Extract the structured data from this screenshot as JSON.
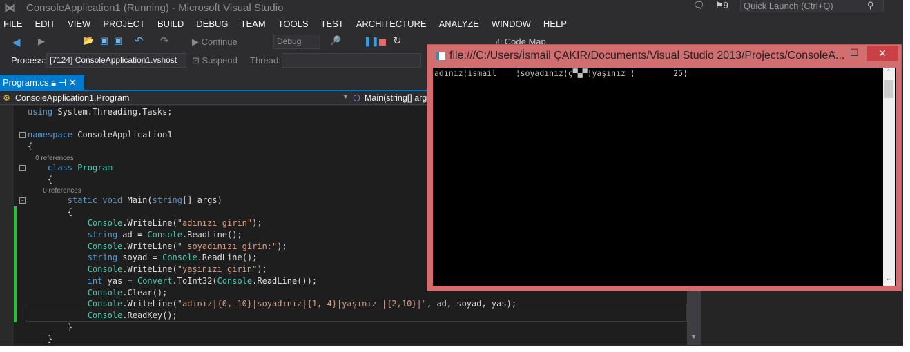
{
  "window": {
    "title": "ConsoleApplication1 (Running) - Microsoft Visual Studio",
    "quick_launch_placeholder": "Quick Launch (Ctrl+Q)",
    "notification_count": "9"
  },
  "menu": [
    "FILE",
    "EDIT",
    "VIEW",
    "PROJECT",
    "BUILD",
    "DEBUG",
    "TEAM",
    "TOOLS",
    "TEST",
    "ARCHITECTURE",
    "ANALYZE",
    "WINDOW",
    "HELP"
  ],
  "toolbar": {
    "continue": "Continue",
    "config": "Debug",
    "code_map": "Code Map",
    "process_label": "Process:",
    "process_value": "[7124] ConsoleApplication1.vshost",
    "suspend": "Suspend",
    "thread_label": "Thread:"
  },
  "tab": {
    "label": "Program.cs"
  },
  "navbar": {
    "class": "ConsoleApplication1.Program",
    "member": "Main(string[] args)"
  },
  "code": [
    [
      [
        "kw",
        "using"
      ],
      [
        "pl",
        " System.Threading.Tasks;"
      ]
    ],
    [],
    [
      [
        "kw",
        "namespace"
      ],
      [
        "pl",
        " ConsoleApplication1"
      ]
    ],
    [
      [
        "pl",
        "{"
      ]
    ],
    [
      [
        "refs",
        "    0 references"
      ]
    ],
    [
      [
        "pl",
        "    "
      ],
      [
        "kw",
        "class"
      ],
      [
        "pl",
        " "
      ],
      [
        "ty",
        "Program"
      ]
    ],
    [
      [
        "pl",
        "    {"
      ]
    ],
    [
      [
        "refs",
        "        0 references"
      ]
    ],
    [
      [
        "pl",
        "        "
      ],
      [
        "kw",
        "static void"
      ],
      [
        "pl",
        " Main("
      ],
      [
        "kw",
        "string"
      ],
      [
        "pl",
        "[] args)"
      ]
    ],
    [
      [
        "pl",
        "        {"
      ]
    ],
    [
      [
        "pl",
        "            "
      ],
      [
        "ty",
        "Console"
      ],
      [
        "pl",
        ".WriteLine("
      ],
      [
        "st",
        "\"adınızı girin\""
      ],
      [
        "pl",
        ");"
      ]
    ],
    [
      [
        "pl",
        "            "
      ],
      [
        "kw",
        "string"
      ],
      [
        "pl",
        " ad = "
      ],
      [
        "ty",
        "Console"
      ],
      [
        "pl",
        ".ReadLine();"
      ]
    ],
    [
      [
        "pl",
        "            "
      ],
      [
        "ty",
        "Console"
      ],
      [
        "pl",
        ".WriteLine("
      ],
      [
        "st",
        "\" soyadınızı girin:\""
      ],
      [
        "pl",
        ");"
      ]
    ],
    [
      [
        "pl",
        "            "
      ],
      [
        "kw",
        "string"
      ],
      [
        "pl",
        " soyad = "
      ],
      [
        "ty",
        "Console"
      ],
      [
        "pl",
        ".ReadLine();"
      ]
    ],
    [
      [
        "pl",
        "            "
      ],
      [
        "ty",
        "Console"
      ],
      [
        "pl",
        ".WriteLine("
      ],
      [
        "st",
        "\"yaşınızı girin\""
      ],
      [
        "pl",
        ");"
      ]
    ],
    [
      [
        "pl",
        "            "
      ],
      [
        "kw",
        "int"
      ],
      [
        "pl",
        " yas = "
      ],
      [
        "ty",
        "Convert"
      ],
      [
        "pl",
        ".ToInt32("
      ],
      [
        "ty",
        "Console"
      ],
      [
        "pl",
        ".ReadLine());"
      ]
    ],
    [
      [
        "pl",
        "            "
      ],
      [
        "ty",
        "Console"
      ],
      [
        "pl",
        ".Clear();"
      ]
    ],
    [
      [
        "pl",
        "            "
      ],
      [
        "ty",
        "Console"
      ],
      [
        "pl",
        ".WriteLine("
      ],
      [
        "st",
        "\"adınız|{0,-10}|soyadınız|{1,-4}|yaşınız |{2,10}|\""
      ],
      [
        "pl",
        ", ad, soyad, yas);"
      ]
    ],
    [
      [
        "pl",
        "            "
      ],
      [
        "ty",
        "Console"
      ],
      [
        "pl",
        ".ReadKey();"
      ]
    ],
    [
      [
        "pl",
        "        }"
      ]
    ],
    [
      [
        "pl",
        "    }"
      ]
    ]
  ],
  "console": {
    "title": "file:///C:/Users/İsmail ÇAKIR/Documents/Visual Studio 2013/Projects/ConsoleA...",
    "output": "adınız¦ismail    ¦soyadınız¦ç▀▄▀¦yaşınız ¦        25¦"
  }
}
